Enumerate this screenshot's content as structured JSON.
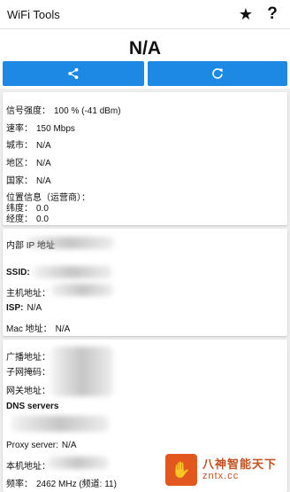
{
  "app": {
    "title": "WiFi Tools"
  },
  "icons": {
    "star": "star-icon",
    "help": "help-icon",
    "share": "share-icon",
    "refresh": "refresh-icon"
  },
  "colors": {
    "accent": "#1e88e5",
    "background": "#eeeeee"
  },
  "status": {
    "value": "N/A"
  },
  "signal_card": {
    "signal_label": "信号强度：",
    "signal_value": "100 % (-41 dBm)",
    "speed_label": "速率：",
    "speed_value": "150 Mbps",
    "city_label": "城市：",
    "city_value": "N/A",
    "region_label": "地区：",
    "region_value": "N/A",
    "country_label": "国家：",
    "country_value": "N/A",
    "location_label": "位置信息（运营商）：",
    "lat_label": "纬度：",
    "lat_value": "0.0",
    "lon_label": "经度：",
    "lon_value": "0.0"
  },
  "network_card": {
    "ip_label": "内部 IP 地址",
    "ssid_label": "SSID:",
    "host_label": "主机地址：",
    "isp_label": "ISP:",
    "isp_value": "N/A",
    "mac_label": "Mac 地址：",
    "mac_value": "N/A"
  },
  "dns_card": {
    "broadcast_label": "广播地址：",
    "mask_label": "子网掩码：",
    "gateway_label": "网关地址：",
    "dns_label": "DNS servers",
    "proxy_label": "Proxy server:",
    "proxy_value": "N/A",
    "local_label": "本机地址：",
    "freq_label": "频率：",
    "freq_value": "2462 MHz (频道: 11)"
  },
  "watermark": {
    "name": "八神智能天下",
    "url": "zntx.cc"
  }
}
